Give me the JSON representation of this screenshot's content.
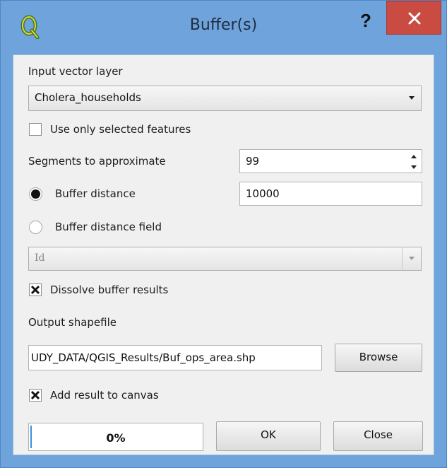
{
  "window": {
    "title": "Buffer(s)",
    "help_label": "?",
    "icons": {
      "app": "qgis-logo-icon",
      "close": "close-icon"
    },
    "colors": {
      "frame": "#6fa3dc",
      "close_button": "#c94b41",
      "client": "#f0f0f0",
      "progress_fill": "#3c8fe0"
    }
  },
  "input_layer": {
    "label": "Input vector layer",
    "selected": "Cholera_households"
  },
  "use_selected": {
    "label": "Use only selected features",
    "checked": false
  },
  "segments": {
    "label": "Segments to approximate",
    "value": "99"
  },
  "buffer_distance": {
    "label": "Buffer distance",
    "value": "10000",
    "selected": true
  },
  "buffer_distance_field": {
    "label": "Buffer distance field",
    "selected": false,
    "field_value": "Id"
  },
  "dissolve": {
    "label": "Dissolve buffer results",
    "checked": true
  },
  "output": {
    "label": "Output shapefile",
    "value": "UDY_DATA/QGIS_Results/Buf_ops_area.shp",
    "browse_label": "Browse"
  },
  "add_to_canvas": {
    "label": "Add result to canvas",
    "checked": true
  },
  "progress": {
    "text": "0%",
    "value": 0
  },
  "buttons": {
    "ok": "OK",
    "close": "Close"
  }
}
